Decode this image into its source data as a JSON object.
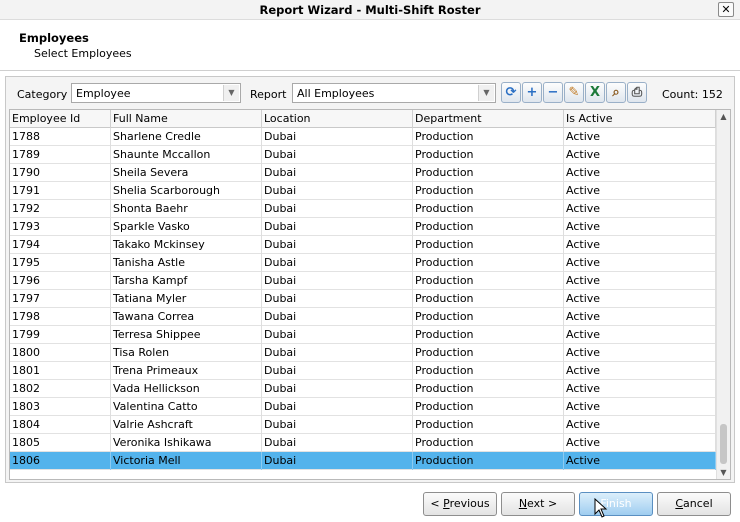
{
  "window": {
    "title": "Report Wizard - Multi-Shift Roster",
    "close_glyph": "✕"
  },
  "header": {
    "title": "Employees",
    "subtitle": "Select Employees"
  },
  "filters": {
    "category_label": "Category",
    "category_value": "Employee",
    "report_label": "Report",
    "report_value": "All Employees",
    "count_label": "Count:",
    "count_value": "152"
  },
  "toolbar_icons": [
    "refresh-icon",
    "add-icon",
    "remove-icon",
    "edit-icon",
    "excel-export-icon",
    "search-icon",
    "print-icon"
  ],
  "grid": {
    "columns": [
      "Employee Id",
      "Full Name",
      "Location",
      "Department",
      "Is Active"
    ],
    "rows": [
      [
        "1788",
        "Sharlene Credle",
        "Dubai",
        "Production",
        "Active"
      ],
      [
        "1789",
        "Shaunte Mccallon",
        "Dubai",
        "Production",
        "Active"
      ],
      [
        "1790",
        "Sheila Severa",
        "Dubai",
        "Production",
        "Active"
      ],
      [
        "1791",
        "Shelia Scarborough",
        "Dubai",
        "Production",
        "Active"
      ],
      [
        "1792",
        "Shonta Baehr",
        "Dubai",
        "Production",
        "Active"
      ],
      [
        "1793",
        "Sparkle Vasko",
        "Dubai",
        "Production",
        "Active"
      ],
      [
        "1794",
        "Takako Mckinsey",
        "Dubai",
        "Production",
        "Active"
      ],
      [
        "1795",
        "Tanisha Astle",
        "Dubai",
        "Production",
        "Active"
      ],
      [
        "1796",
        "Tarsha Kampf",
        "Dubai",
        "Production",
        "Active"
      ],
      [
        "1797",
        "Tatiana Myler",
        "Dubai",
        "Production",
        "Active"
      ],
      [
        "1798",
        "Tawana Correa",
        "Dubai",
        "Production",
        "Active"
      ],
      [
        "1799",
        "Terresa Shippee",
        "Dubai",
        "Production",
        "Active"
      ],
      [
        "1800",
        "Tisa Rolen",
        "Dubai",
        "Production",
        "Active"
      ],
      [
        "1801",
        "Trena Primeaux",
        "Dubai",
        "Production",
        "Active"
      ],
      [
        "1802",
        "Vada Hellickson",
        "Dubai",
        "Production",
        "Active"
      ],
      [
        "1803",
        "Valentina Catto",
        "Dubai",
        "Production",
        "Active"
      ],
      [
        "1804",
        "Valrie Ashcraft",
        "Dubai",
        "Production",
        "Active"
      ],
      [
        "1805",
        "Veronika Ishikawa",
        "Dubai",
        "Production",
        "Active"
      ],
      [
        "1806",
        "Victoria Mell",
        "Dubai",
        "Production",
        "Active"
      ]
    ],
    "selected_index": 18
  },
  "buttons": {
    "previous": {
      "mnemonic": "P",
      "rest": "revious",
      "prefix": "< "
    },
    "next": {
      "mnemonic": "N",
      "rest": "ext >",
      "prefix": ""
    },
    "finish": {
      "mnemonic": "F",
      "rest": "inish",
      "prefix": ""
    },
    "cancel": {
      "mnemonic": "C",
      "rest": "ancel",
      "prefix": ""
    }
  },
  "colors": {
    "selection": "#53b3ec",
    "accent": "#2a6fc4"
  }
}
